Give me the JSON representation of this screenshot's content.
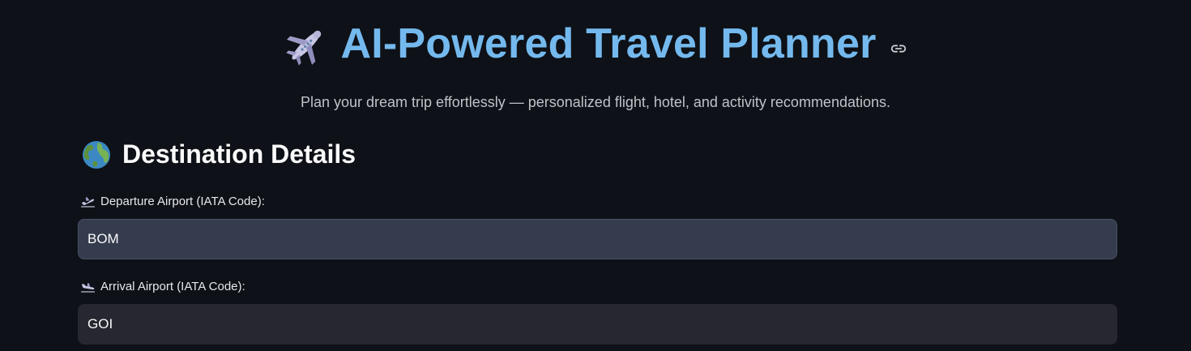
{
  "header": {
    "title_emoji": "✈️",
    "title": "AI-Powered Travel Planner",
    "subtitle": "Plan your dream trip effortlessly — personalized flight, hotel, and activity recommendations."
  },
  "section": {
    "title": "Destination Details"
  },
  "fields": {
    "departure": {
      "label": "Departure Airport (IATA Code):",
      "value": "BOM"
    },
    "arrival": {
      "label": "Arrival Airport (IATA Code):",
      "value": "GOI"
    }
  },
  "colors": {
    "background": "#0e1117",
    "title": "#74b9ee",
    "input_focused": "#353c4e",
    "input": "#262730"
  }
}
